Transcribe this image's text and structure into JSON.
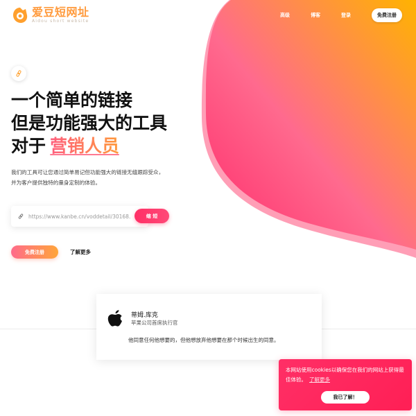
{
  "brand": {
    "name": "爱豆短网址",
    "tagline": "Aidou short website",
    "accent": "#ff9a3c"
  },
  "nav": {
    "items": [
      "高级",
      "博客",
      "登录"
    ],
    "register_label": "免费注册"
  },
  "hero": {
    "title_line1": "一个简单的链接",
    "title_line2": "但是功能强大的工具",
    "title_line3_prefix": "对于",
    "title_highlight": "营销人员",
    "description": "我们的工具可让您通过简单易记但功能强大的链接无缝跟踪受众，并为客户提供独特的量身定制的体验。",
    "url_placeholder": "https://www.kanbe.cn/voddetail/30168.",
    "shorten_label": "缩 短",
    "cta_register": "免费注册",
    "cta_more": "了解更多"
  },
  "testimonial": {
    "name": "蒂姆.库克",
    "role": "苹果公司首席执行官",
    "quote": "他同意任何他想要的，但他想放弃他想要在那个时候出生的同意。",
    "logo_icon": "apple-icon"
  },
  "cookie_banner": {
    "text": "本网站使用cookies以确保您在我们的网站上获得最佳体验。",
    "link": "了解更多",
    "accept": "我已了解！"
  },
  "colors": {
    "gradient_orange": "#ffb000",
    "gradient_pink": "#ff5f8a",
    "gradient_red": "#ff1f55"
  }
}
